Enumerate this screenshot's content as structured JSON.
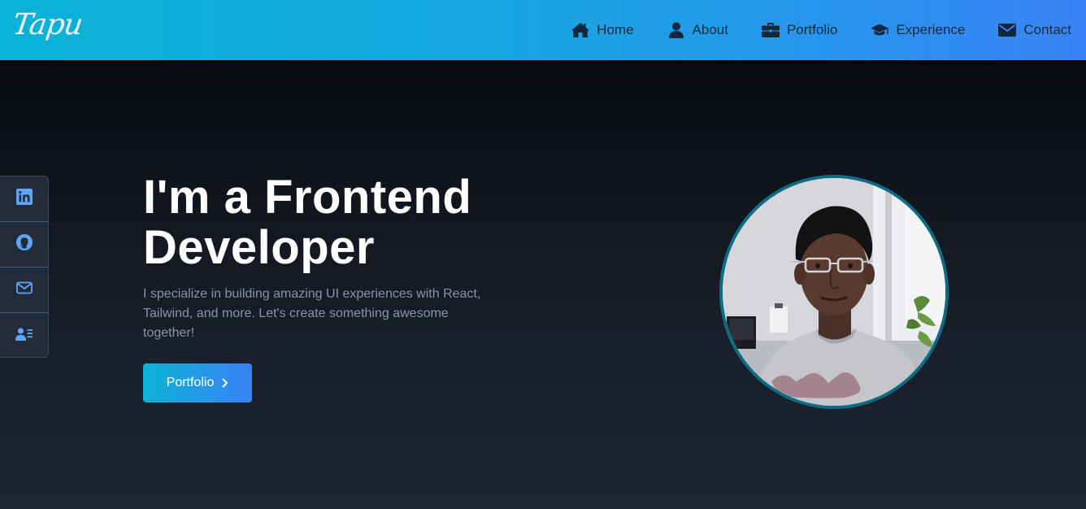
{
  "logo": "Tapu",
  "nav": {
    "home": "Home",
    "about": "About",
    "portfolio": "Portfolio",
    "experience": "Experience",
    "contact": "Contact"
  },
  "social": [
    {
      "icon": "linkedin-icon"
    },
    {
      "icon": "github-icon"
    },
    {
      "icon": "mail-icon"
    },
    {
      "icon": "contact-card-icon"
    }
  ],
  "hero": {
    "headline_line1": "I'm a Frontend",
    "headline_line2": "Developer",
    "description": "I specialize in building amazing UI experiences with React, Tailwind, and more. Let's create something awesome together!",
    "cta_label": "Portfolio"
  },
  "colors": {
    "nav_gradient_start": "#0ab3d6",
    "nav_gradient_end": "#3b82f6",
    "accent": "#60a5fa",
    "avatar_ring": "#0e6b84"
  }
}
